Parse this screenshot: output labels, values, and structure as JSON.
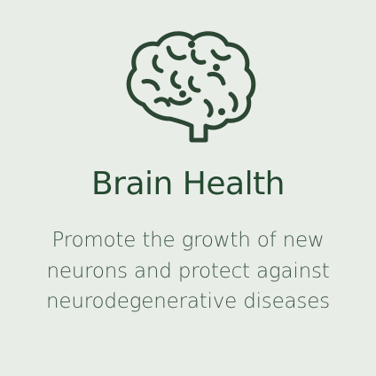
{
  "card": {
    "icon": "brain-icon",
    "title": "Brain Health",
    "description": "Promote the growth of new neurons and protect against neurodegenerative diseases"
  },
  "colors": {
    "background": "#e9ede8",
    "icon_stroke": "#2c4733",
    "title": "#244a30",
    "description": "#3e5a45"
  }
}
